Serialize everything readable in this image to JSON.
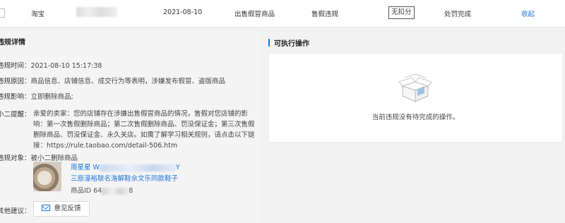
{
  "top_row": {
    "platform": "淘宝",
    "date": "2021-08-10",
    "violation_type": "出售假冒商品",
    "severity": "售假违规",
    "penalty": "无扣分",
    "status": "处罚完成",
    "action": "收起"
  },
  "details": {
    "title": "违规详情",
    "time_label": "违规时间：",
    "time_value": "2021-08-10 15:17:38",
    "reason_label": "违规原因：",
    "reason_value": "商品信息、店铺信息、成交行为等表明，涉嫌发布假冒、盗版商品",
    "impact_label": "违规影响：",
    "impact_value": "立即删除商品;",
    "tip_label": "小二提醒：",
    "tip_value": "亲爱的卖家：您的店铺存在涉嫌出售假冒商品的情况，售假对您店铺的影响：第一次售假删除商品；第二次售假删除商品、罚没保证金；第三次售假删除商品、罚没保证金、永久关店。如需了解学习相关规则，请点击以下链接：https://rule.taobao.com/detail-506.htm",
    "object_label": "违规对象：",
    "object_value": "被小二删除商品",
    "product": {
      "line1_prefix": "周星星 W",
      "line1_suffix": "Y",
      "line2": "三原濠裕联名洛解鞋余文乐同款鞋子",
      "id_label": "商品ID 64",
      "id_suffix": "8"
    },
    "suggestion_label": "其他建议：",
    "feedback_label": "意见反馈"
  },
  "actions": {
    "title": "可执行操作",
    "empty_text": "当前违规没有待完成的操作。"
  },
  "colors": {
    "accent": "#1a74d9",
    "panel_bg": "#f4f4f4",
    "card_bg": "#ffffff"
  }
}
